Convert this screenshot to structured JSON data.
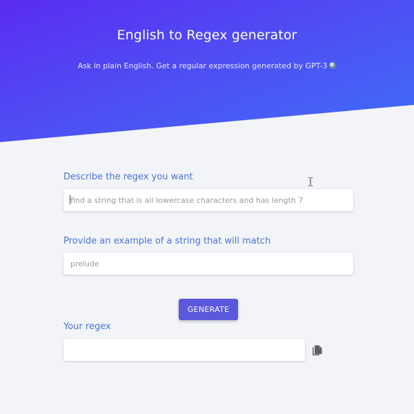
{
  "header": {
    "title": "English to Regex generator",
    "subtitle": "Ask in plain English. Get a regular expression generated by GPT-3"
  },
  "form": {
    "describe_label": "Describe the regex you want",
    "describe_placeholder": "find a string that is all lowercase characters and has length 7",
    "describe_value": "",
    "example_label": "Provide an example of a string that will match",
    "example_placeholder": "prelude",
    "example_value": "",
    "generate_label": "GENERATE",
    "result_label": "Your regex",
    "result_value": ""
  },
  "icons": {
    "copy": "copy-icon",
    "cursor": "text-cursor-icon",
    "emoji": "crystal-ball-emoji-icon"
  },
  "colors": {
    "hero_gradient_start": "#5a2cf2",
    "hero_gradient_end": "#3f6ef7",
    "label": "#4a72d6",
    "button": "#5a58dc",
    "background": "#f2f4f7"
  }
}
